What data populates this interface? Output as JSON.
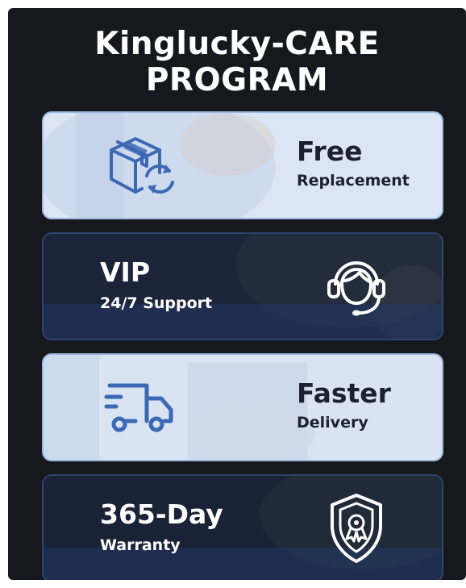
{
  "header": {
    "line1": "Kinglucky-CARE",
    "line2": "PROGRAM"
  },
  "cards": [
    {
      "title": "Free",
      "subtitle": "Replacement",
      "icon": "box-refresh-icon",
      "theme": "light"
    },
    {
      "title": "VIP",
      "subtitle": "24/7 Support",
      "icon": "headset-icon",
      "theme": "dark"
    },
    {
      "title": "Faster",
      "subtitle": "Delivery",
      "icon": "delivery-truck-icon",
      "theme": "light"
    },
    {
      "title": "365-Day",
      "subtitle": "Warranty",
      "icon": "shield-badge-icon",
      "theme": "dark"
    }
  ],
  "colors": {
    "panel": "#16181e",
    "light_card": "#d6e2f3",
    "dark_card": "#1d2a44",
    "icon_blue": "#3d68b4",
    "accent_border": "#6f93d0"
  }
}
